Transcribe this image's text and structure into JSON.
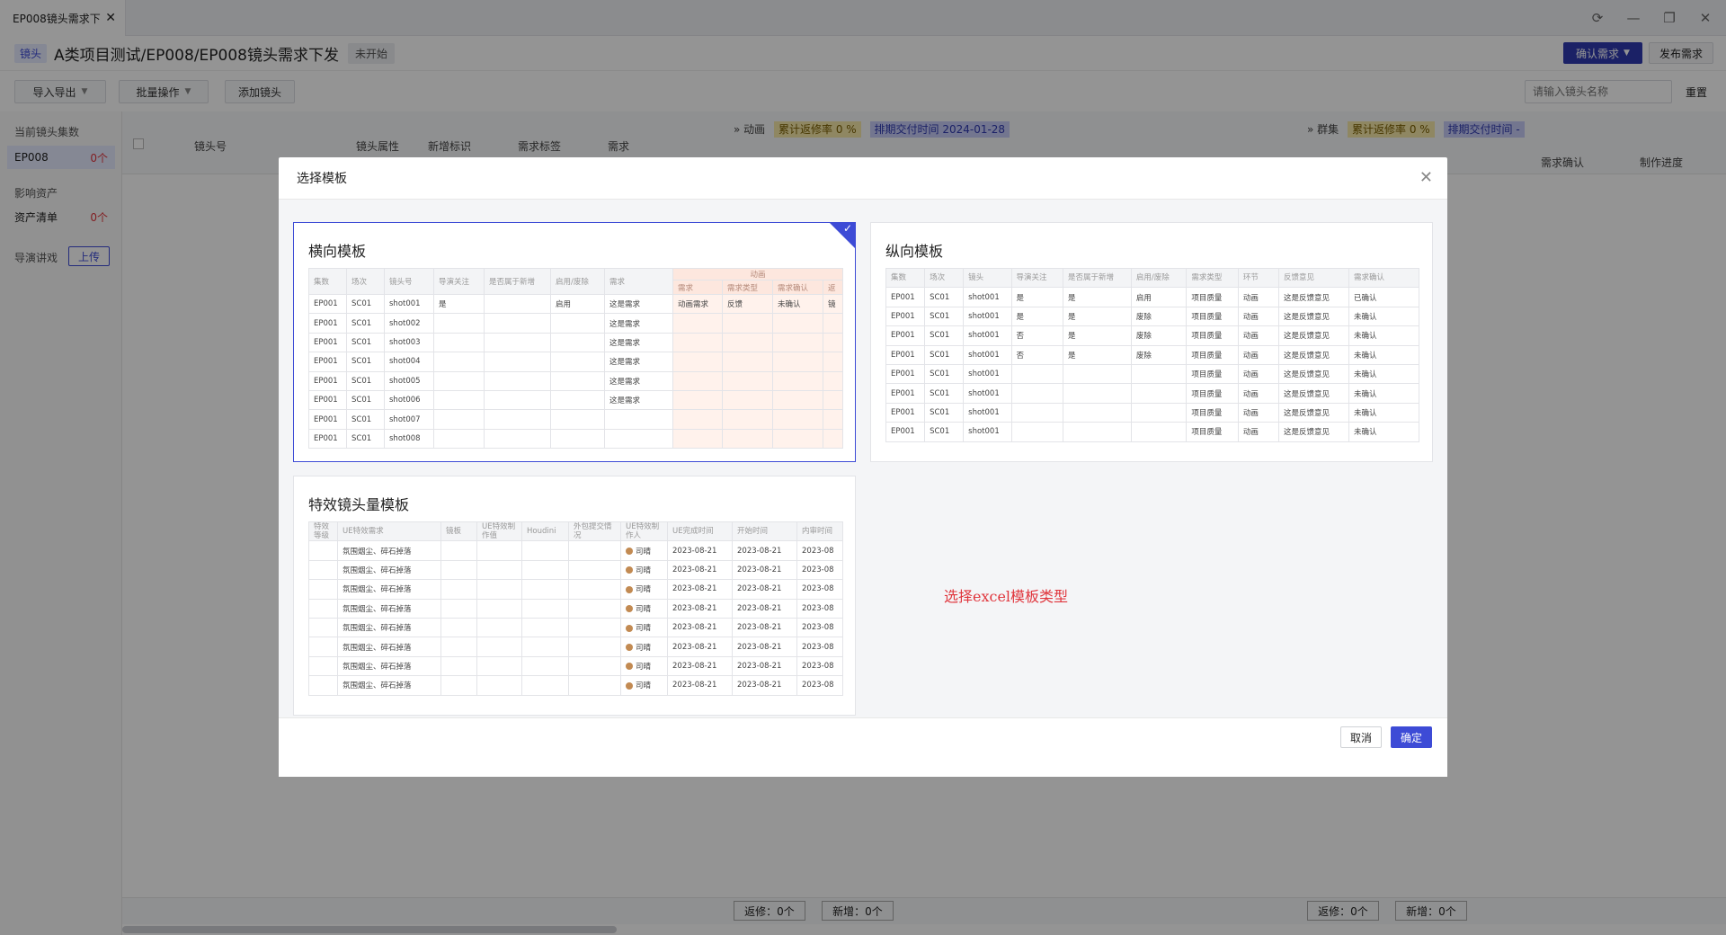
{
  "tab": {
    "label": "EP008镜头需求下",
    "close": "✕"
  },
  "window_controls": {
    "refresh": "⟳",
    "minimize": "—",
    "restore": "❐",
    "close": "✕"
  },
  "header": {
    "tag": "镜头",
    "title": "A类项目测试/EP008/EP008镜头需求下发",
    "status": "未开始",
    "confirm_button": "确认需求",
    "publish_button": "发布需求"
  },
  "toolbar": {
    "import_export": "导入导出",
    "batch": "批量操作",
    "add_shot": "添加镜头",
    "search_placeholder": "请输入镜头名称",
    "reset": "重置"
  },
  "sidebar": {
    "current_section": "当前镜头集数",
    "current_item": {
      "label": "EP008",
      "count": "0个"
    },
    "asset_section": "影响资产",
    "asset_item": {
      "label": "资产清单",
      "count": "0个"
    },
    "director_label": "导演讲戏",
    "upload": "上传"
  },
  "grid": {
    "columns": [
      "镜头号",
      "镜头属性",
      "新增标识",
      "需求标签",
      "需求"
    ],
    "group1": {
      "name": "动画",
      "rate": "累计返修率 0 %",
      "delivery": "排期交付时间 2024-01-28"
    },
    "group2": {
      "name": "群集",
      "rate": "累计返修率 0 %",
      "delivery": "排期交付时间 -"
    },
    "right_columns": [
      "需求确认",
      "制作进度"
    ],
    "footer": {
      "fix1": "返修：0个",
      "new1": "新增：0个",
      "fix2": "返修：0个",
      "new2": "新增：0个"
    }
  },
  "modal": {
    "title": "选择模板",
    "hint": "选择excel模板类型",
    "cancel": "取消",
    "ok": "确定",
    "templates": [
      {
        "title": "横向模板",
        "selected": true,
        "header": [
          "集数",
          "场次",
          "镜头号",
          "导演关注",
          "是否属于新增",
          "启用/废除",
          "需求"
        ],
        "anim_group": "动画",
        "anim_sub": [
          "需求",
          "需求类型",
          "需求确认",
          "返"
        ],
        "rows": [
          [
            "EP001",
            "SC01",
            "shot001",
            "是",
            "",
            "启用",
            "这是需求",
            "动画需求",
            "反馈",
            "未确认",
            "镜"
          ],
          [
            "EP001",
            "SC01",
            "shot002",
            "",
            "",
            "",
            "这是需求",
            "",
            "",
            "",
            ""
          ],
          [
            "EP001",
            "SC01",
            "shot003",
            "",
            "",
            "",
            "这是需求",
            "",
            "",
            "",
            ""
          ],
          [
            "EP001",
            "SC01",
            "shot004",
            "",
            "",
            "",
            "这是需求",
            "",
            "",
            "",
            ""
          ],
          [
            "EP001",
            "SC01",
            "shot005",
            "",
            "",
            "",
            "这是需求",
            "",
            "",
            "",
            ""
          ],
          [
            "EP001",
            "SC01",
            "shot006",
            "",
            "",
            "",
            "这是需求",
            "",
            "",
            "",
            ""
          ],
          [
            "EP001",
            "SC01",
            "shot007",
            "",
            "",
            "",
            "",
            "",
            "",
            "",
            ""
          ],
          [
            "EP001",
            "SC01",
            "shot008",
            "",
            "",
            "",
            "",
            "",
            "",
            "",
            ""
          ]
        ]
      },
      {
        "title": "纵向模板",
        "selected": false,
        "header": [
          "集数",
          "场次",
          "镜头",
          "导演关注",
          "是否属于新增",
          "启用/废除",
          "需求类型",
          "环节",
          "反馈意见",
          "需求确认"
        ],
        "rows": [
          [
            "EP001",
            "SC01",
            "shot001",
            "是",
            "是",
            "启用",
            "项目质量",
            "动画",
            "这是反馈意见",
            "已确认"
          ],
          [
            "EP001",
            "SC01",
            "shot001",
            "是",
            "是",
            "废除",
            "项目质量",
            "动画",
            "这是反馈意见",
            "未确认"
          ],
          [
            "EP001",
            "SC01",
            "shot001",
            "否",
            "是",
            "废除",
            "项目质量",
            "动画",
            "这是反馈意见",
            "未确认"
          ],
          [
            "EP001",
            "SC01",
            "shot001",
            "否",
            "是",
            "废除",
            "项目质量",
            "动画",
            "这是反馈意见",
            "未确认"
          ],
          [
            "EP001",
            "SC01",
            "shot001",
            "",
            "",
            "",
            "项目质量",
            "动画",
            "这是反馈意见",
            "未确认"
          ],
          [
            "EP001",
            "SC01",
            "shot001",
            "",
            "",
            "",
            "项目质量",
            "动画",
            "这是反馈意见",
            "未确认"
          ],
          [
            "EP001",
            "SC01",
            "shot001",
            "",
            "",
            "",
            "项目质量",
            "动画",
            "这是反馈意见",
            "未确认"
          ],
          [
            "EP001",
            "SC01",
            "shot001",
            "",
            "",
            "",
            "项目质量",
            "动画",
            "这是反馈意见",
            "未确认"
          ]
        ]
      },
      {
        "title": "特效镜头量模板",
        "selected": false,
        "header": [
          "特效等级",
          "UE特效需求",
          "镜板",
          "UE特效制作值",
          "Houdini",
          "外包提交情况",
          "UE特效制作人",
          "UE完成时间",
          "开始时间",
          "内审时间"
        ],
        "rows": [
          [
            "",
            "氛围烟尘、碎石掉落",
            "",
            "",
            "",
            "",
            "司晴",
            "2023-08-21",
            "2023-08-21",
            "2023-08"
          ],
          [
            "",
            "氛围烟尘、碎石掉落",
            "",
            "",
            "",
            "",
            "司晴",
            "2023-08-21",
            "2023-08-21",
            "2023-08"
          ],
          [
            "",
            "氛围烟尘、碎石掉落",
            "",
            "",
            "",
            "",
            "司晴",
            "2023-08-21",
            "2023-08-21",
            "2023-08"
          ],
          [
            "",
            "氛围烟尘、碎石掉落",
            "",
            "",
            "",
            "",
            "司晴",
            "2023-08-21",
            "2023-08-21",
            "2023-08"
          ],
          [
            "",
            "氛围烟尘、碎石掉落",
            "",
            "",
            "",
            "",
            "司晴",
            "2023-08-21",
            "2023-08-21",
            "2023-08"
          ],
          [
            "",
            "氛围烟尘、碎石掉落",
            "",
            "",
            "",
            "",
            "司晴",
            "2023-08-21",
            "2023-08-21",
            "2023-08"
          ],
          [
            "",
            "氛围烟尘、碎石掉落",
            "",
            "",
            "",
            "",
            "司晴",
            "2023-08-21",
            "2023-08-21",
            "2023-08"
          ],
          [
            "",
            "氛围烟尘、碎石掉落",
            "",
            "",
            "",
            "",
            "司晴",
            "2023-08-21",
            "2023-08-21",
            "2023-08"
          ]
        ]
      }
    ]
  }
}
